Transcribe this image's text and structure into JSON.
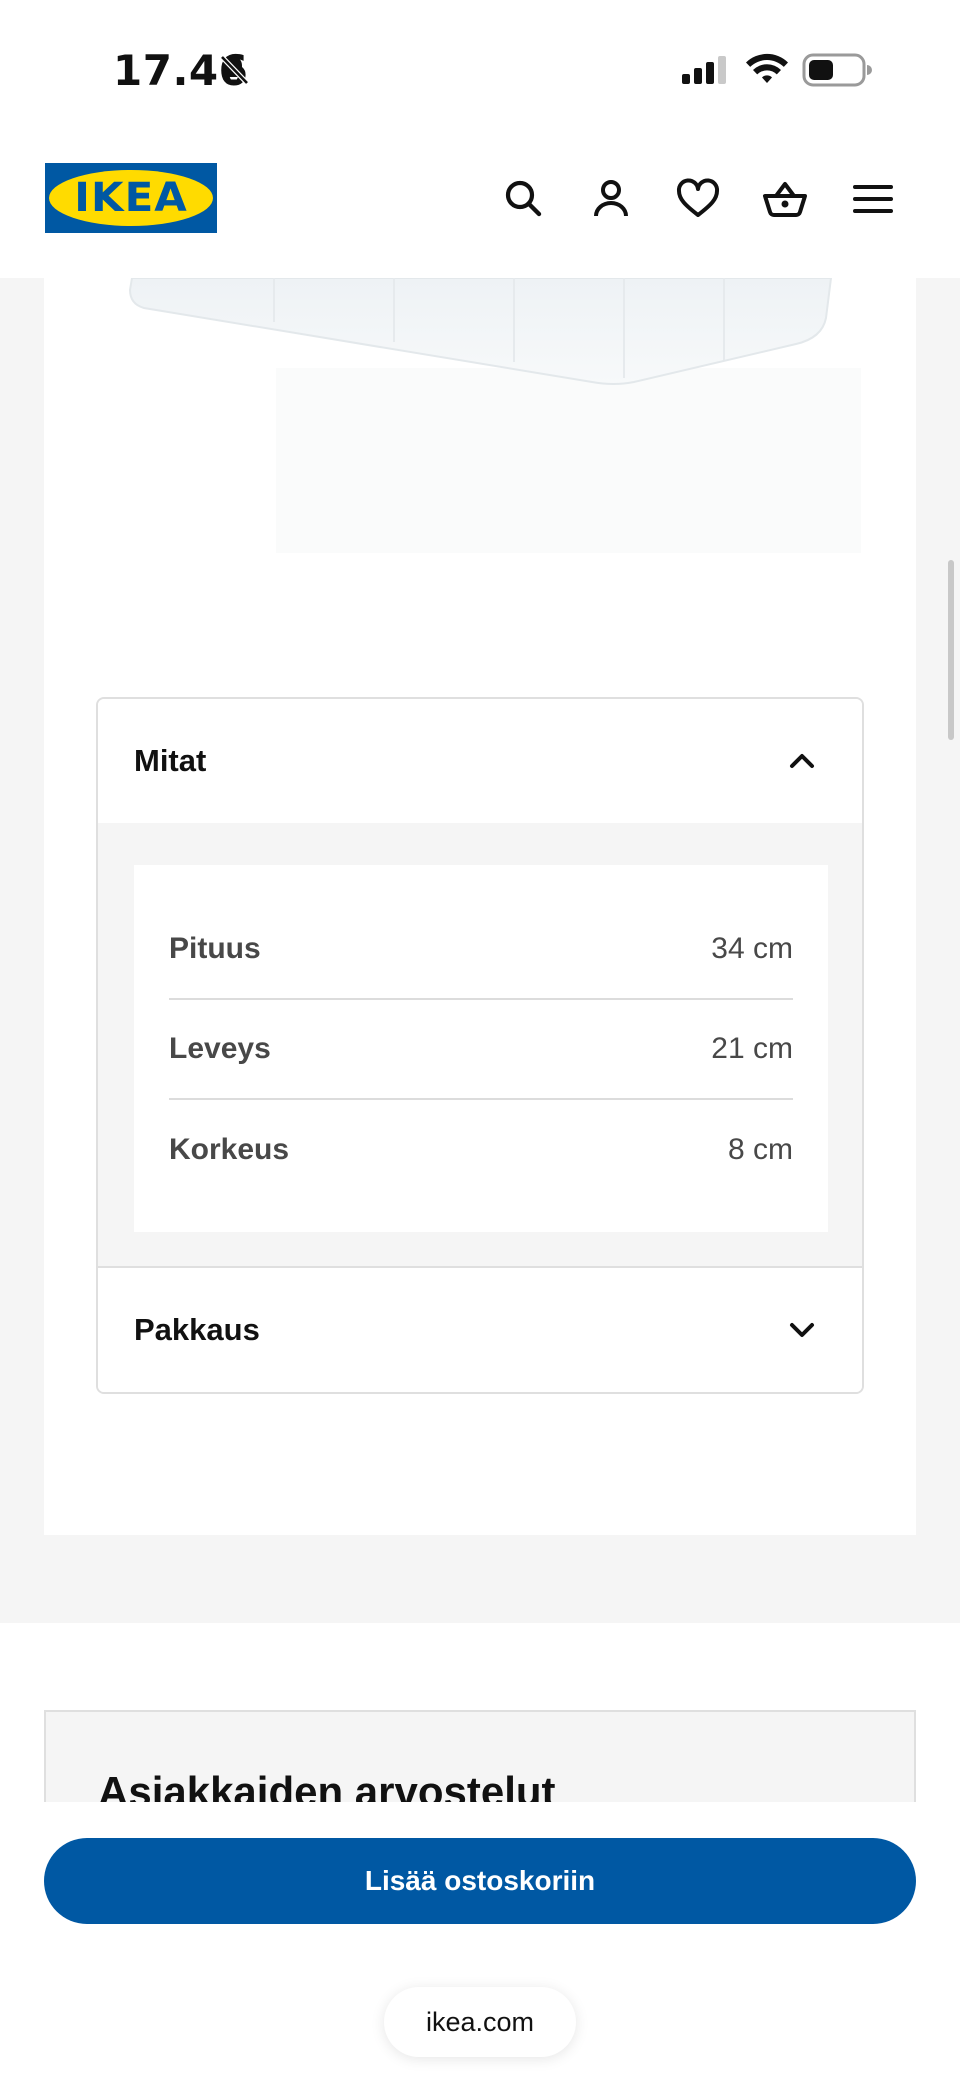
{
  "status_bar": {
    "time": "17.46",
    "icons": [
      "bell-off-icon",
      "signal-icon",
      "wifi-icon",
      "battery-icon"
    ]
  },
  "header": {
    "logo_text": "IKEA",
    "icons": [
      "search-icon",
      "account-icon",
      "heart-icon",
      "cart-icon",
      "menu-icon"
    ]
  },
  "colors": {
    "brand_blue": "#0058a3",
    "brand_yellow": "#ffdb00",
    "page_grey": "#f5f5f5"
  },
  "dimensions_section": {
    "title": "Mitat",
    "expanded": true,
    "rows": [
      {
        "label": "Pituus",
        "value": "34 cm"
      },
      {
        "label": "Leveys",
        "value": "21 cm"
      },
      {
        "label": "Korkeus",
        "value": "8 cm"
      }
    ]
  },
  "packaging_section": {
    "title": "Pakkaus",
    "expanded": false
  },
  "reviews": {
    "title": "Asiakkaiden arvostelut"
  },
  "actions": {
    "add_to_cart_label": "Lisää ostoskoriin"
  },
  "browser": {
    "url": "ikea.com"
  }
}
